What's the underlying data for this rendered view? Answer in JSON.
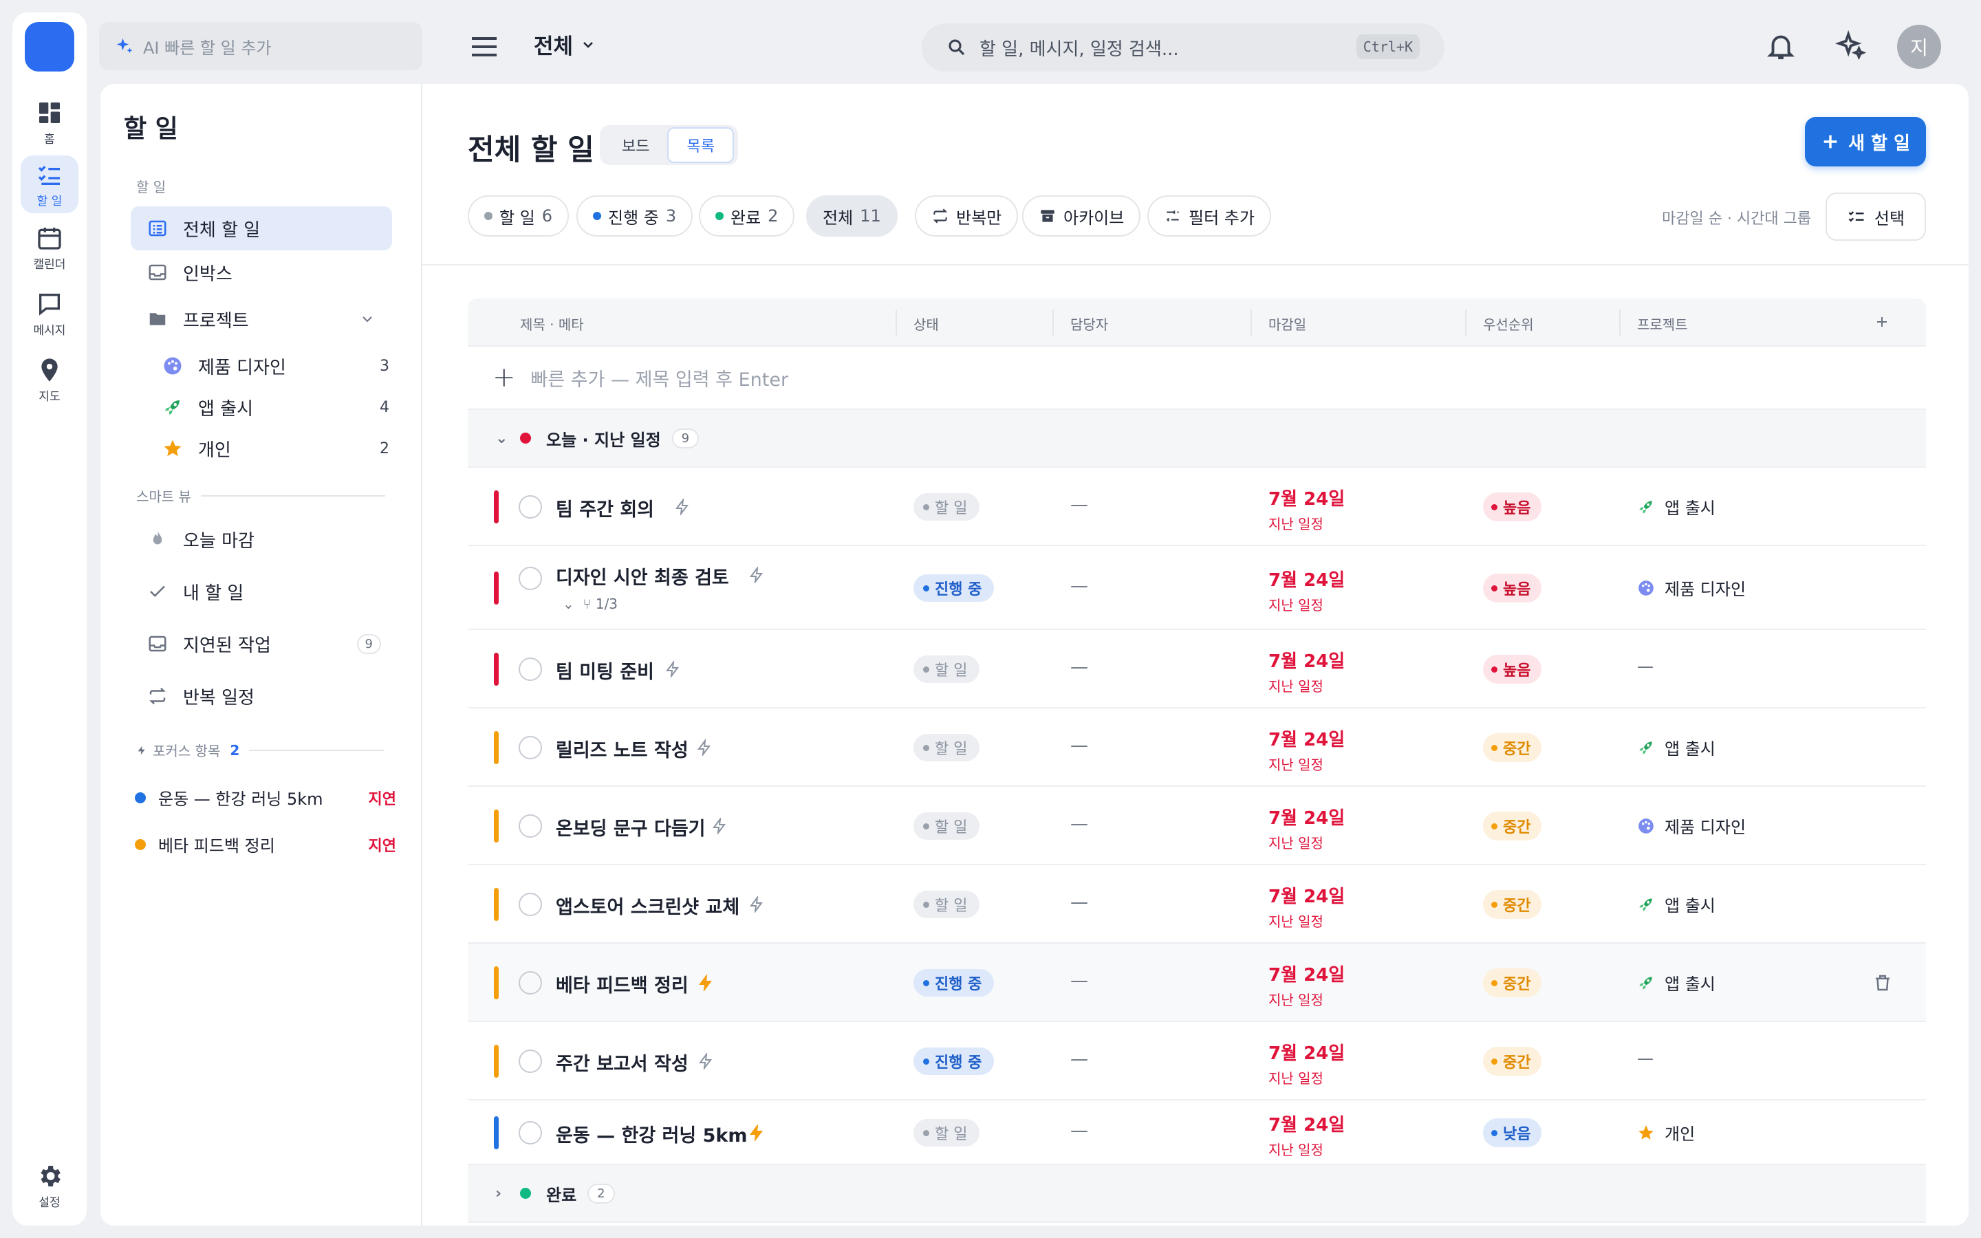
{
  "rail": {
    "items": [
      {
        "label": "홈",
        "icon": "dashboard-icon"
      },
      {
        "label": "할 일",
        "icon": "checklist-icon",
        "active": true
      },
      {
        "label": "캘린더",
        "icon": "calendar-icon"
      },
      {
        "label": "메시지",
        "icon": "chat-icon"
      },
      {
        "label": "지도",
        "icon": "map-pin-icon"
      }
    ],
    "settings_label": "설정"
  },
  "topbar": {
    "ai_placeholder": "AI 빠른 할 일 추가",
    "scope_label": "전체",
    "search_placeholder": "할 일, 메시지, 일정 검색...",
    "search_shortcut": "Ctrl+K",
    "avatar_initial": "지"
  },
  "sidebar": {
    "title": "할 일",
    "section_tasks": "할 일",
    "items": [
      {
        "label": "전체 할 일",
        "active": true
      },
      {
        "label": "인박스"
      },
      {
        "label": "프로젝트"
      }
    ],
    "projects": [
      {
        "label": "제품 디자인",
        "count": "3",
        "icon": "palette-icon"
      },
      {
        "label": "앱 출시",
        "count": "4",
        "icon": "rocket-icon"
      },
      {
        "label": "개인",
        "count": "2",
        "icon": "star-icon"
      }
    ],
    "section_smart": "스마트 뷰",
    "smart": [
      {
        "label": "오늘 마감",
        "icon": "flame-icon"
      },
      {
        "label": "내 할 일",
        "icon": "check-icon"
      },
      {
        "label": "지연된 작업",
        "icon": "inbox-icon",
        "count": "9"
      },
      {
        "label": "반복 일정",
        "icon": "repeat-icon"
      }
    ],
    "section_focus": "포커스 항목",
    "focus_count": "2",
    "focus": [
      {
        "label": "운동 — 한강 러닝 5km",
        "status": "지연",
        "color": "#1f72e0"
      },
      {
        "label": "베타 피드백 정리",
        "status": "지연",
        "color": "#f59e0b"
      }
    ]
  },
  "main": {
    "title": "전체 할 일",
    "view_board": "보드",
    "view_list": "목록",
    "new_task": "새 할 일",
    "chips": [
      {
        "label": "할 일",
        "count": "6",
        "color": "#9aa1ad"
      },
      {
        "label": "진행 중",
        "count": "3",
        "color": "#1f72e0"
      },
      {
        "label": "완료",
        "count": "2",
        "color": "#10b981"
      },
      {
        "label": "전체",
        "count": "11",
        "selected": true
      },
      {
        "label": "반복만",
        "icon": "repeat-icon"
      },
      {
        "label": "아카이브",
        "icon": "archive-icon"
      },
      {
        "label": "필터 추가",
        "icon": "sliders-icon"
      }
    ],
    "sort_label": "마감일 순 · 시간대 그룹",
    "select_label": "선택"
  },
  "table": {
    "headers": [
      "제목 · 메타",
      "상태",
      "담당자",
      "마감일",
      "우선순위",
      "프로젝트"
    ],
    "quick_add": "빠른 추가 — 제목 입력 후 Enter",
    "group_today": {
      "label": "오늘 · 지난 일정",
      "count": "9",
      "color": "#e0133b"
    },
    "group_done": {
      "label": "완료",
      "count": "2",
      "color": "#10b981"
    },
    "rows": [
      {
        "title": "팀 주간 회의",
        "status": "할 일",
        "assignee": "—",
        "due": "7월 24일",
        "due_note": "지난 일정",
        "priority": "높음",
        "project": "앱 출시",
        "bar": "#e0133b"
      },
      {
        "title": "디자인 시안 최종 검토",
        "subtasks": "1/3",
        "status": "진행 중",
        "assignee": "—",
        "due": "7월 24일",
        "due_note": "지난 일정",
        "priority": "높음",
        "project": "제품 디자인",
        "bar": "#e0133b"
      },
      {
        "title": "팀 미팅 준비",
        "status": "할 일",
        "assignee": "—",
        "due": "7월 24일",
        "due_note": "지난 일정",
        "priority": "높음",
        "project": "—",
        "bar": "#e0133b"
      },
      {
        "title": "릴리즈 노트 작성",
        "status": "할 일",
        "assignee": "—",
        "due": "7월 24일",
        "due_note": "지난 일정",
        "priority": "중간",
        "project": "앱 출시",
        "bar": "#f59e0b"
      },
      {
        "title": "온보딩 문구 다듬기",
        "status": "할 일",
        "assignee": "—",
        "due": "7월 24일",
        "due_note": "지난 일정",
        "priority": "중간",
        "project": "제품 디자인",
        "bar": "#f59e0b"
      },
      {
        "title": "앱스토어 스크린샷 교체",
        "status": "할 일",
        "assignee": "—",
        "due": "7월 24일",
        "due_note": "지난 일정",
        "priority": "중간",
        "project": "앱 출시",
        "bar": "#f59e0b"
      },
      {
        "title": "베타 피드백 정리",
        "status": "진행 중",
        "assignee": "—",
        "due": "7월 24일",
        "due_note": "지난 일정",
        "priority": "중간",
        "project": "앱 출시",
        "bar": "#f59e0b"
      },
      {
        "title": "주간 보고서 작성",
        "status": "진행 중",
        "assignee": "—",
        "due": "7월 24일",
        "due_note": "지난 일정",
        "priority": "중간",
        "project": "—",
        "bar": "#f59e0b"
      },
      {
        "title": "운동 — 한강 러닝 5km",
        "status": "할 일",
        "assignee": "—",
        "due": "7월 24일",
        "due_note": "지난 일정",
        "priority": "낮음",
        "project": "개인",
        "bar": "#1f72e0"
      }
    ]
  }
}
